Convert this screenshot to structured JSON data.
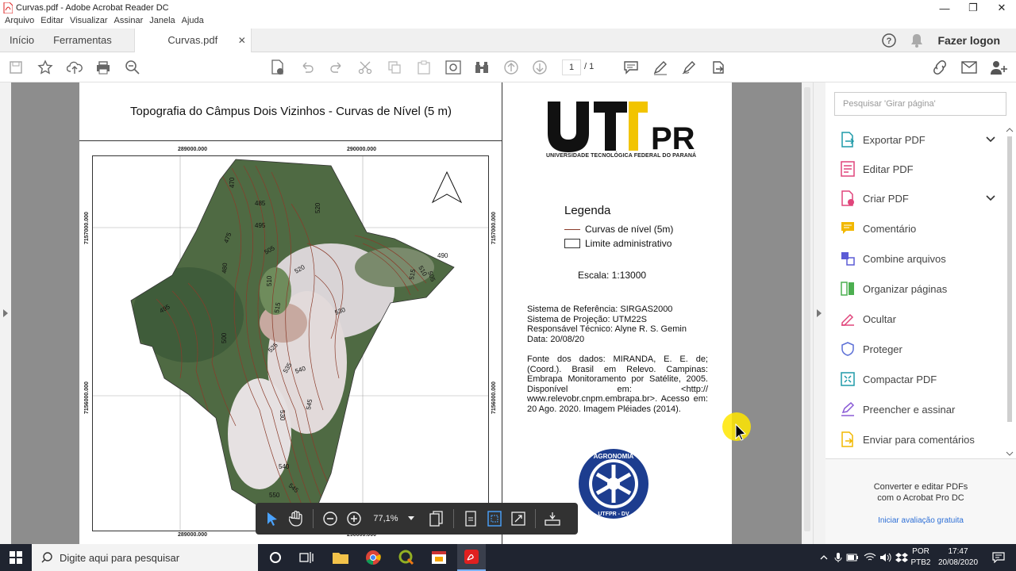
{
  "window": {
    "title": "Curvas.pdf - Adobe Acrobat Reader DC",
    "minimize": "—",
    "maximize": "❐",
    "close": "✕"
  },
  "menu": [
    "Arquivo",
    "Editar",
    "Visualizar",
    "Assinar",
    "Janela",
    "Ajuda"
  ],
  "tabs": {
    "home": "Início",
    "tools": "Ferramentas",
    "doc": "Curvas.pdf",
    "close": "✕"
  },
  "header": {
    "logon": "Fazer logon",
    "help": "?"
  },
  "toolbar": {
    "page_current": "1",
    "page_total": "/ 1"
  },
  "document": {
    "map_title": "Topografia do Câmpus Dois Vizinhos - Curvas de Nível (5 m)",
    "coords": {
      "x_top_1": "289000.000",
      "x_top_2": "290000.000",
      "x_bottom_1": "289000.000",
      "x_bottom_2": "290000.000",
      "y_left_1": "7157000.000",
      "y_left_2": "7156000.000",
      "y_right_1": "7157000.000",
      "y_right_2": "7156000.000"
    },
    "contour_labels": [
      "470",
      "485",
      "495",
      "520",
      "475",
      "480",
      "505",
      "520",
      "510",
      "515",
      "490",
      "510",
      "505",
      "495",
      "530",
      "515",
      "500",
      "525",
      "535",
      "540",
      "530",
      "545",
      "540",
      "545",
      "550"
    ],
    "logo_text": "UTFPR",
    "logo_subtitle": "UNIVERSIDADE TECNOLÓGICA FEDERAL DO PARANÁ",
    "legend_title": "Legenda",
    "legend_items": [
      "Curvas de nível (5m)",
      "Limite administrativo"
    ],
    "scale": "Escala: 1:13000",
    "info_lines": [
      "Sistema de Referência: SIRGAS2000",
      "Sistema de Projeção: UTM22S",
      "Responsável Técnico: Alyne R. S. Gemin",
      "Data: 20/08/20"
    ],
    "fonte": "Fonte dos dados: MIRANDA, E. E. de; (Coord.). Brasil em Relevo. Campinas: Embrapa Monitoramento por Satélite, 2005. Disponível em: <http:// www.relevobr.cnpm.embrapa.br>. Acesso em: 20 Ago. 2020. Imagem Pléiades (2014).",
    "seal_top": "AGRONOMIA",
    "seal_bottom": "UTFPR - DV"
  },
  "floatbar": {
    "zoom": "77,1%"
  },
  "panel": {
    "search_placeholder": "Pesquisar 'Girar página'",
    "items": [
      {
        "label": "Exportar PDF",
        "icon": "export-pdf-icon",
        "color": "#1f9aa8"
      },
      {
        "label": "Editar PDF",
        "icon": "edit-pdf-icon",
        "color": "#e0457b"
      },
      {
        "label": "Criar PDF",
        "icon": "create-pdf-icon",
        "color": "#e0457b"
      },
      {
        "label": "Comentário",
        "icon": "comment-icon",
        "color": "#f2b800"
      },
      {
        "label": "Combine arquivos",
        "icon": "combine-icon",
        "color": "#5b5bd6"
      },
      {
        "label": "Organizar páginas",
        "icon": "organize-icon",
        "color": "#4caf50"
      },
      {
        "label": "Ocultar",
        "icon": "redact-icon",
        "color": "#e0457b"
      },
      {
        "label": "Proteger",
        "icon": "protect-icon",
        "color": "#5b6fd6"
      },
      {
        "label": "Compactar PDF",
        "icon": "compress-icon",
        "color": "#1f9aa8"
      },
      {
        "label": "Preencher e assinar",
        "icon": "fill-sign-icon",
        "color": "#8a5bd6"
      },
      {
        "label": "Enviar para comentários",
        "icon": "send-comment-icon",
        "color": "#f2b800"
      }
    ],
    "footer_text_1": "Converter e editar PDFs",
    "footer_text_2": "com o Acrobat Pro DC",
    "footer_link": "Iniciar avaliação gratuita"
  },
  "taskbar": {
    "search_placeholder": "Digite aqui para pesquisar",
    "lang_1": "POR",
    "lang_2": "PTB2",
    "time": "17:47",
    "date": "20/08/2020"
  }
}
